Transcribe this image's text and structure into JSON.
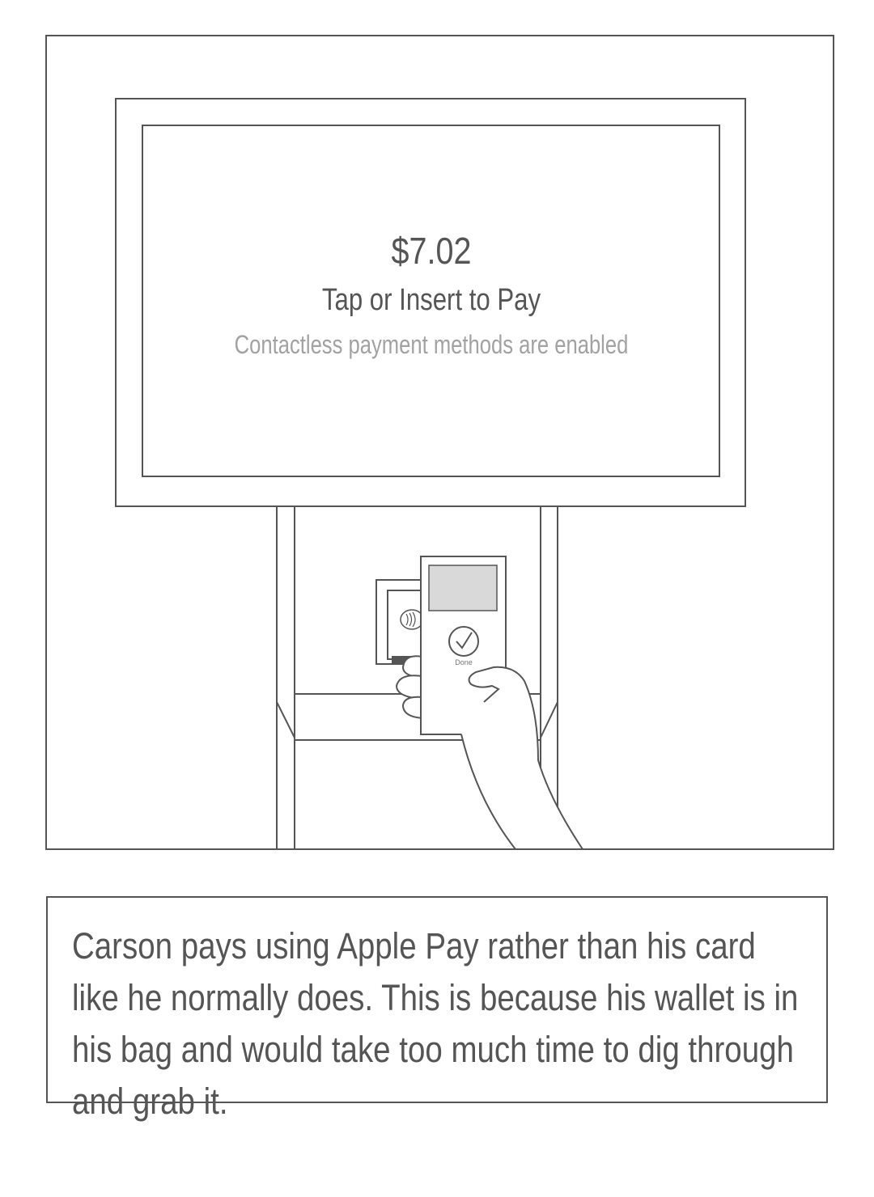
{
  "screen": {
    "amount": "$7.02",
    "prompt": "Tap or Insert to Pay",
    "subprompt": "Contactless payment methods are enabled"
  },
  "phone": {
    "done_label": "Done"
  },
  "caption": {
    "text": "Carson pays using Apple Pay rather than his card like he normally does. This is because his wallet is in his bag and would take too much time to dig through and grab it."
  },
  "colors": {
    "line": "#555555",
    "muted_text": "#a2a2a2",
    "phone_screen": "#d9d9d9"
  }
}
